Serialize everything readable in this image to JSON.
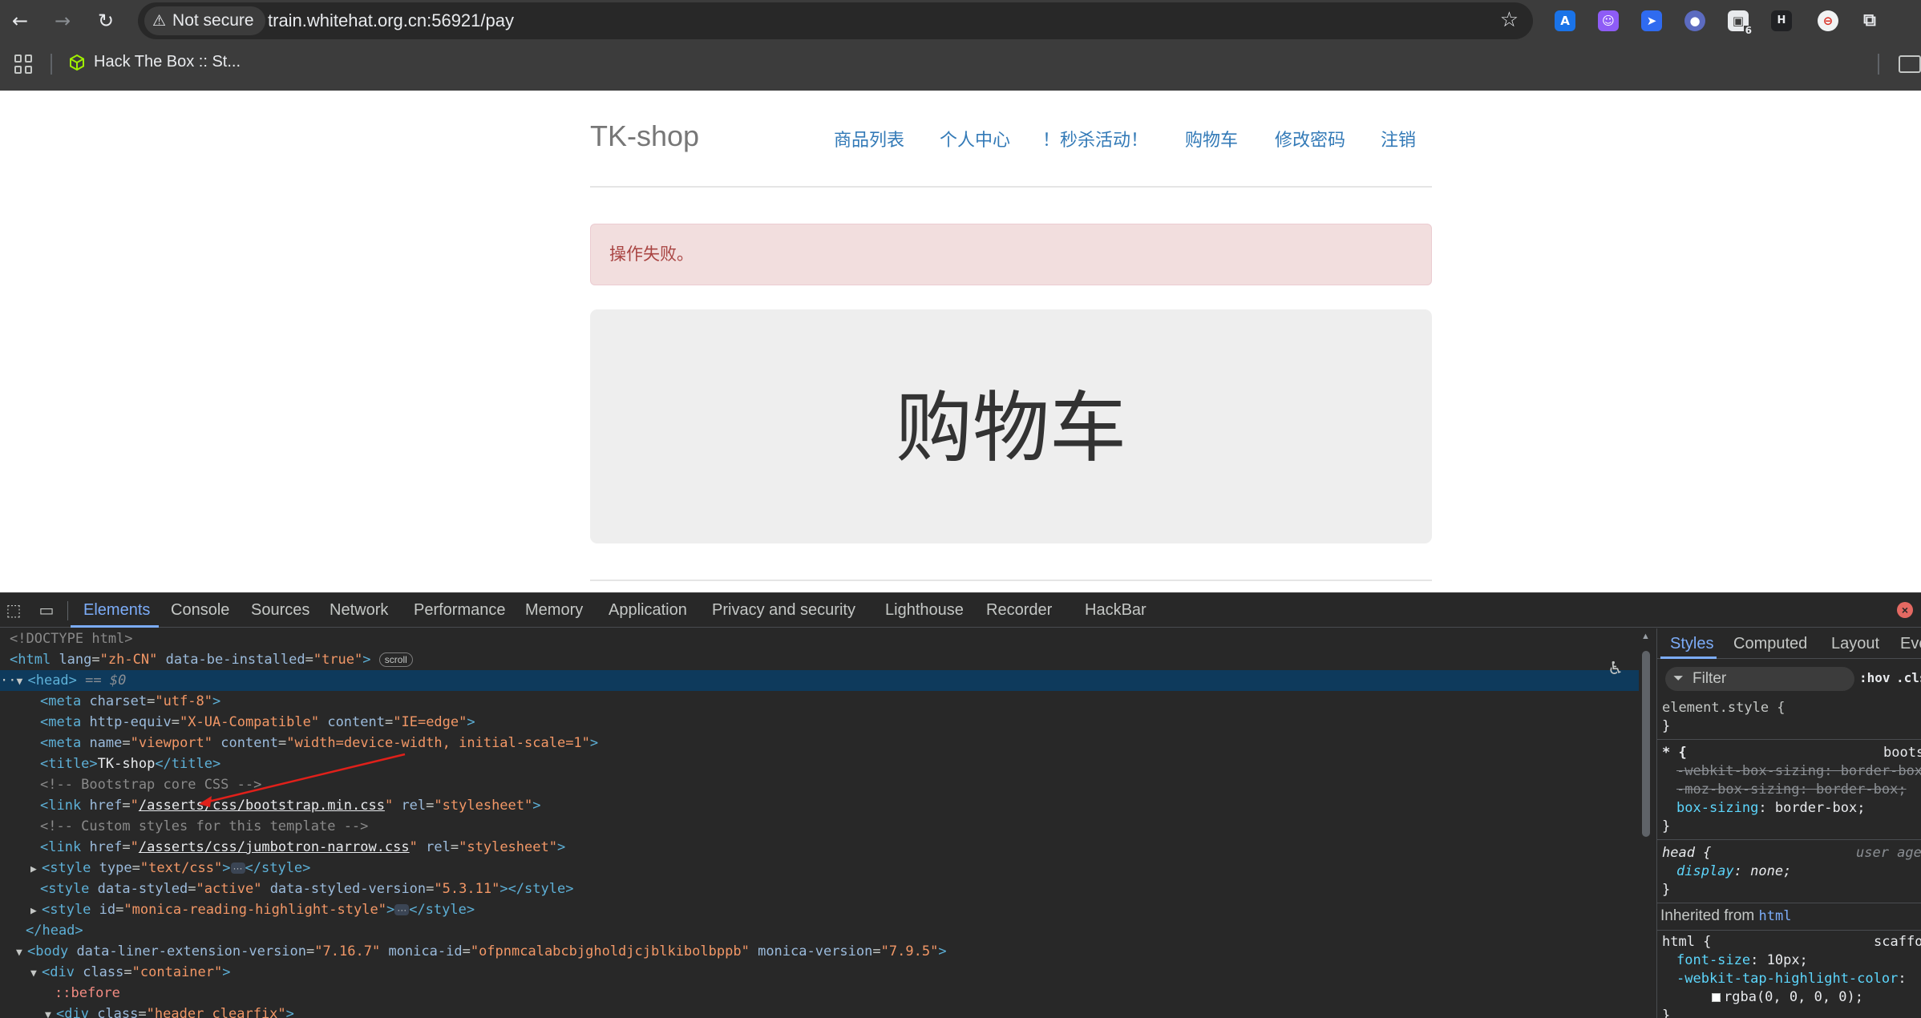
{
  "browser": {
    "security_label": "Not secure",
    "url": "train.whitehat.org.cn:56921/pay",
    "bookmark": "Hack The Box :: St...",
    "extension_badge": "6"
  },
  "page": {
    "brand": "TK-shop",
    "nav": [
      "商品列表",
      "个人中心",
      "！秒杀活动！",
      "购物车",
      "修改密码",
      "注销"
    ],
    "alert": "操作失败。",
    "jumbotron_title": "购物车"
  },
  "devtools": {
    "tabs": [
      "Elements",
      "Console",
      "Sources",
      "Network",
      "Performance",
      "Memory",
      "Application",
      "Privacy and security",
      "Lighthouse",
      "Recorder",
      "HackBar"
    ],
    "active_tab": "Elements",
    "code": {
      "doctype": "<!DOCTYPE html>",
      "html_lang": "zh-CN",
      "html_be": "true",
      "scroll_badge": "scroll",
      "head_ref": "== $0",
      "meta_charset": "utf-8",
      "meta_http_equiv": "X-UA-Compatible",
      "meta_http_content": "IE=edge",
      "meta_viewport_name": "viewport",
      "meta_viewport_content": "width=device-width, initial-scale=1",
      "title_text": "TK-shop",
      "comment1": "<!-- Bootstrap core CSS -->",
      "link1_href": "/asserts/css/bootstrap.min.css",
      "link_rel": "stylesheet",
      "comment2": "<!-- Custom styles for this template -->",
      "link2_href": "/asserts/css/jumbotron-narrow.css",
      "style1_type": "text/css",
      "style2_styled": "active",
      "style2_version": "5.3.11",
      "style3_id": "monica-reading-highlight-style",
      "body_liner": "7.16.7",
      "body_monica_id": "ofpnmcalabcbjgholdjcjblkibolbppb",
      "body_monica_version": "7.9.5",
      "div_container": "container",
      "pseudo_before": "::before",
      "div_header": "header clearfix"
    },
    "styles": {
      "tabs": [
        "Styles",
        "Computed",
        "Layout",
        "Eve"
      ],
      "filter_placeholder": "Filter",
      "hov": ":hov",
      "cls": ".cls",
      "element_style": "element.style {",
      "close_brace": "}",
      "star_selector": "* {",
      "star_source": "boots",
      "webkit_box_sizing": "-webkit-box-sizing: border-box",
      "moz_box_sizing": "-moz-box-sizing: border-box;",
      "box_sizing_prop": "box-sizing",
      "box_sizing_value": "border-box;",
      "head_selector": "head {",
      "head_source": "user age",
      "display_prop": "display",
      "display_value": "none;",
      "inherited_from": "Inherited from",
      "inherited_tag": "html",
      "html_selector": "html {",
      "html_source": "scaffo",
      "font_size_prop": "font-size",
      "font_size_value": "10px;",
      "tap_prop": "-webkit-tap-highlight-color",
      "tap_value": "rgba(0, 0, 0, 0);"
    }
  }
}
